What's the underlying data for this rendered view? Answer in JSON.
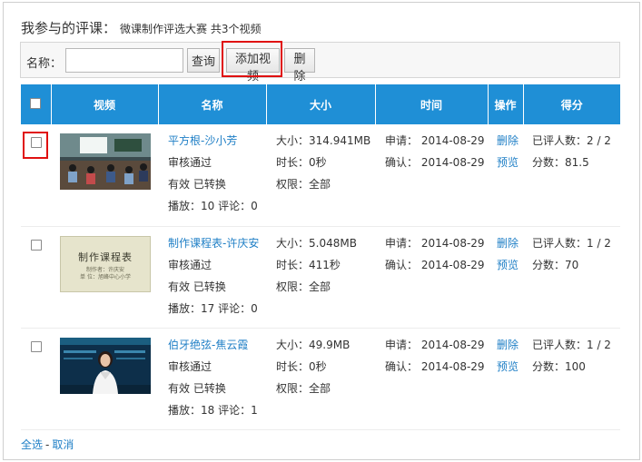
{
  "header": {
    "title": "我参与的评课：",
    "subtitle": "微课制作评选大赛 共3个视频"
  },
  "toolbar": {
    "name_label": "名称：",
    "name_value": "",
    "query_label": "查询",
    "add_label": "添加视频",
    "delete_label": "删除"
  },
  "table": {
    "columns": [
      "视频",
      "名称",
      "大小",
      "时间",
      "操作",
      "得分"
    ],
    "rows": [
      {
        "name": "平方根-沙小芳",
        "status": "审核通过",
        "valid": "有效 已转换",
        "plays": "播放：10 评论：0",
        "size": "大小：314.941MB",
        "duration": "时长：0秒",
        "perm": "权限：全部",
        "apply": "申请： 2014-08-29",
        "confirm": "确认： 2014-08-29",
        "op_delete": "删除",
        "op_preview": "预览",
        "raters": "已评人数：2 / 2",
        "score": "分数：81.5",
        "thumb": "classroom"
      },
      {
        "name": "制作课程表-许庆安",
        "status": "审核通过",
        "valid": "有效 已转换",
        "plays": "播放：17 评论：0",
        "size": "大小：5.048MB",
        "duration": "时长：411秒",
        "perm": "权限：全部",
        "apply": "申请： 2014-08-29",
        "confirm": "确认： 2014-08-29",
        "op_delete": "删除",
        "op_preview": "预览",
        "raters": "已评人数：1 / 2",
        "score": "分数：70",
        "thumb": "slide",
        "thumb_title": "制作课程表",
        "thumb_line1": "制作者：许庆安",
        "thumb_line2": "单 位：旭峰中心小学"
      },
      {
        "name": "伯牙绝弦-焦云霞",
        "status": "审核通过",
        "valid": "有效 已转换",
        "plays": "播放：18 评论：1",
        "size": "大小：49.9MB",
        "duration": "时长：0秒",
        "perm": "权限：全部",
        "apply": "申请： 2014-08-29",
        "confirm": "确认： 2014-08-29",
        "op_delete": "删除",
        "op_preview": "预览",
        "raters": "已评人数：1 / 2",
        "score": "分数：100",
        "thumb": "presenter"
      }
    ]
  },
  "footer": {
    "select_all": "全选",
    "separator": "-",
    "cancel": "取消"
  },
  "colors": {
    "header_blue": "#1f8fd6",
    "link_blue": "#1f7fc6",
    "highlight_red": "#e01010"
  }
}
